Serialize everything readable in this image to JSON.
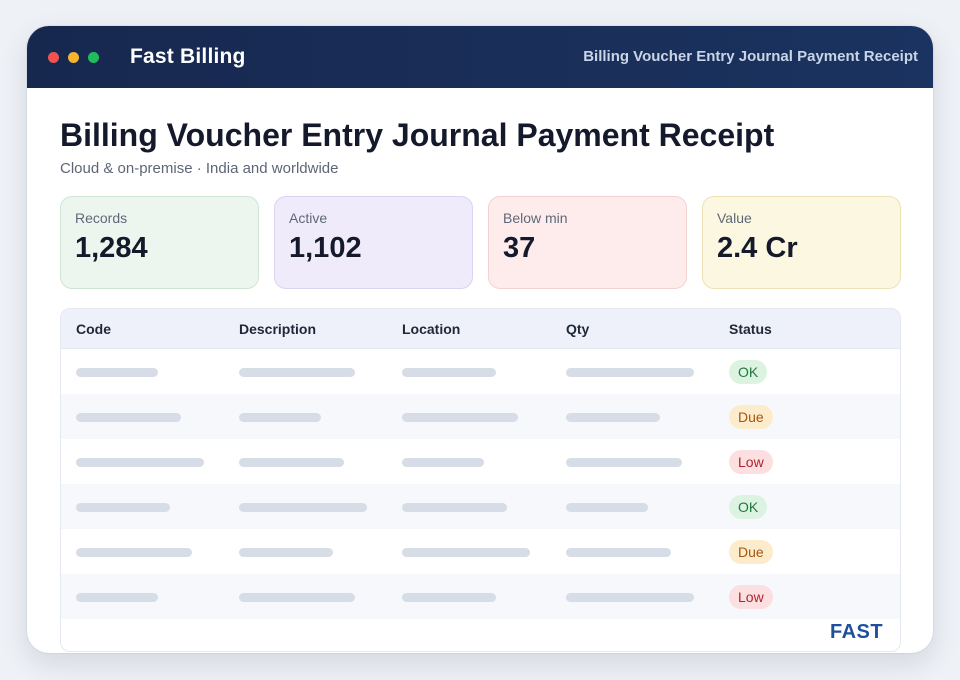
{
  "window": {
    "app_name": "Fast Billing",
    "module": "Billing Voucher Entry Journal Payment Receipt",
    "controls": [
      "close-dot",
      "minimize-dot",
      "maximize-dot"
    ]
  },
  "page": {
    "title": "Billing Voucher Entry Journal Payment Receipt",
    "subtitle": "Cloud & on-premise · India and worldwide"
  },
  "stats": [
    {
      "label": "Records",
      "value": "1,284"
    },
    {
      "label": "Active",
      "value": "1,102"
    },
    {
      "label": "Below min",
      "value": "37"
    },
    {
      "label": "Value",
      "value": "2.4 Cr"
    }
  ],
  "table": {
    "columns": [
      "Code",
      "Description",
      "Location",
      "Qty",
      "Status"
    ],
    "rows": [
      {
        "status": "OK"
      },
      {
        "status": "Due"
      },
      {
        "status": "Low"
      },
      {
        "status": "OK"
      },
      {
        "status": "Due"
      },
      {
        "status": "Low"
      }
    ]
  },
  "brand": "FAST",
  "colors": {
    "titlebar": "#17284f",
    "brand": "#1d4f9a",
    "status_ok": "#23773e",
    "status_due": "#a4560f",
    "status_low": "#b0242c"
  }
}
